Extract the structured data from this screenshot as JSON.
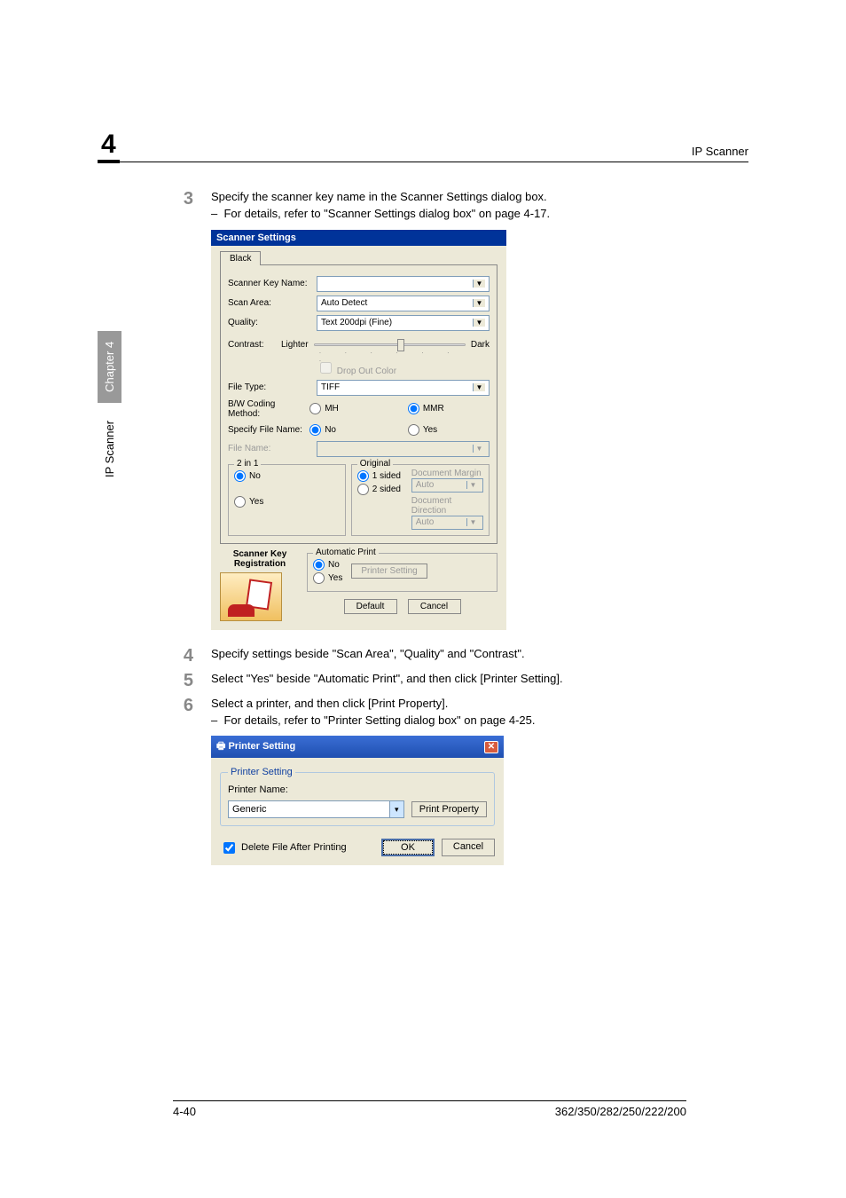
{
  "header": {
    "chapter_num": "4",
    "title": "IP Scanner"
  },
  "sidetab": {
    "section": "IP Scanner",
    "chapter": "Chapter 4"
  },
  "steps": {
    "s3": {
      "num": "3",
      "text": "Specify the scanner key name in the Scanner Settings dialog box.",
      "sub": "For details, refer to \"Scanner Settings dialog box\" on page 4-17."
    },
    "s4": {
      "num": "4",
      "text": "Specify settings beside \"Scan Area\", \"Quality\" and \"Contrast\"."
    },
    "s5": {
      "num": "5",
      "text": "Select \"Yes\" beside \"Automatic Print\", and then click [Printer Setting]."
    },
    "s6": {
      "num": "6",
      "text": "Select a printer, and then click [Print Property].",
      "sub": "For details, refer to \"Printer Setting dialog box\" on page 4-25."
    }
  },
  "scanner_dialog": {
    "title": "Scanner Settings",
    "tab": "Black",
    "scanner_key_name_label": "Scanner Key Name:",
    "scanner_key_name_value": "",
    "scan_area_label": "Scan Area:",
    "scan_area_value": "Auto Detect",
    "quality_label": "Quality:",
    "quality_value": "Text 200dpi (Fine)",
    "contrast_label": "Contrast:",
    "lighter": "Lighter",
    "dark": "Dark",
    "drop_out_color": "Drop Out Color",
    "file_type_label": "File Type:",
    "file_type_value": "TIFF",
    "coding_label": "B/W Coding Method:",
    "coding_mh": "MH",
    "coding_mmr": "MMR",
    "specify_label": "Specify File Name:",
    "no": "No",
    "yes": "Yes",
    "file_name_label": "File Name:",
    "twoin1_legend": "2 in 1",
    "original_legend": "Original",
    "onesided": "1 sided",
    "twosided": "2 sided",
    "doc_margin": "Document Margin",
    "doc_margin_value": "Auto",
    "doc_direction": "Document Direction",
    "doc_direction_value": "Auto",
    "scanner_key_reg": "Scanner Key Registration",
    "auto_print": "Automatic Print",
    "printer_setting_btn": "Printer Setting",
    "default_btn": "Default",
    "cancel_btn": "Cancel"
  },
  "printer_dialog": {
    "title": "Printer Setting",
    "group": "Printer Setting",
    "printer_name_label": "Printer Name:",
    "printer_value": "Generic",
    "print_property_btn": "Print Property",
    "delete_after": "Delete File After Printing",
    "ok": "OK",
    "cancel": "Cancel"
  },
  "footer": {
    "page": "4-40",
    "model": "362/350/282/250/222/200"
  }
}
